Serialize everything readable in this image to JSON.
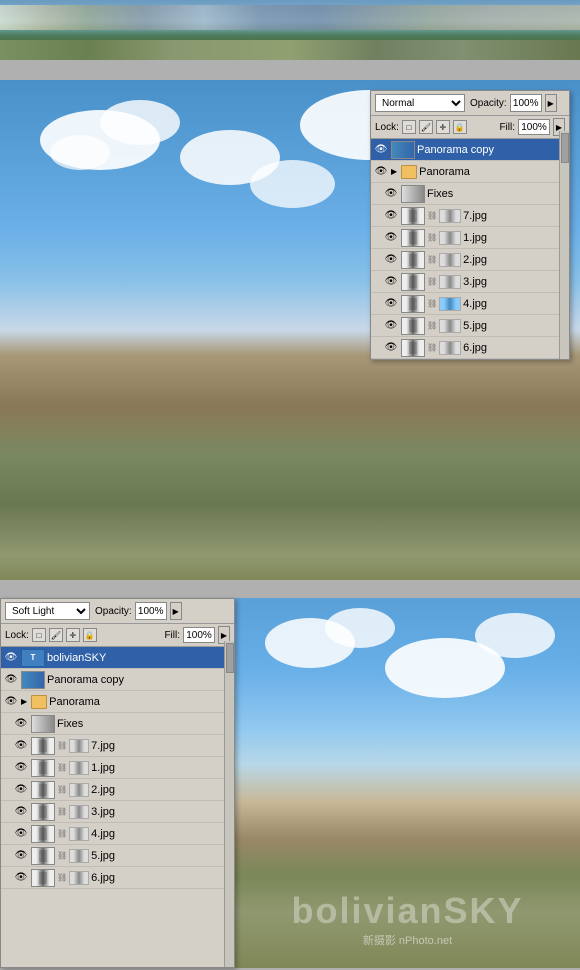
{
  "topPanel": {
    "blendMode": "Normal",
    "opacity": "100%",
    "fill": "100%",
    "lockLabel": "Lock:",
    "opacityLabel": "Opacity:",
    "fillLabel": "Fill:",
    "layers": [
      {
        "id": "panorama-copy",
        "name": "Panorama copy",
        "type": "smart",
        "selected": true,
        "indent": 0
      },
      {
        "id": "panorama-group",
        "name": "Panorama",
        "type": "group",
        "indent": 0
      },
      {
        "id": "fixes",
        "name": "Fixes",
        "type": "adjustment",
        "indent": 1
      },
      {
        "id": "7jpg",
        "name": "7.jpg",
        "type": "file",
        "indent": 1
      },
      {
        "id": "1jpg",
        "name": "1.jpg",
        "type": "file",
        "indent": 1
      },
      {
        "id": "2jpg",
        "name": "2.jpg",
        "type": "file",
        "indent": 1
      },
      {
        "id": "3jpg",
        "name": "3.jpg",
        "type": "file",
        "indent": 1
      },
      {
        "id": "4jpg",
        "name": "4.jpg",
        "type": "file",
        "indent": 1
      },
      {
        "id": "5jpg",
        "name": "5.jpg",
        "type": "file",
        "indent": 1
      },
      {
        "id": "6jpg",
        "name": "6.jpg",
        "type": "file",
        "indent": 1
      }
    ]
  },
  "bottomPanel": {
    "blendMode": "Soft Light",
    "opacity": "100%",
    "fill": "100%",
    "lockLabel": "Lock:",
    "opacityLabel": "Opacity:",
    "fillLabel": "Fill:",
    "layers": [
      {
        "id": "bolivianSKY",
        "name": "bolivianSKY",
        "type": "text",
        "selected": true,
        "indent": 0
      },
      {
        "id": "panorama-copy2",
        "name": "Panorama copy",
        "type": "smart",
        "indent": 0
      },
      {
        "id": "panorama-group2",
        "name": "Panorama",
        "type": "group",
        "indent": 0
      },
      {
        "id": "fixes2",
        "name": "Fixes",
        "type": "adjustment",
        "indent": 1
      },
      {
        "id": "7jpg2",
        "name": "7.jpg",
        "type": "file",
        "indent": 1
      },
      {
        "id": "1jpg2",
        "name": "1.jpg",
        "type": "file",
        "indent": 1
      },
      {
        "id": "2jpg2",
        "name": "2.jpg",
        "type": "file",
        "indent": 1
      },
      {
        "id": "3jpg2",
        "name": "3.jpg",
        "type": "file",
        "indent": 1
      },
      {
        "id": "4jpg2",
        "name": "4.jpg",
        "type": "file",
        "indent": 1
      },
      {
        "id": "5jpg2",
        "name": "5.jpg",
        "type": "file",
        "indent": 1
      },
      {
        "id": "6jpg2",
        "name": "6.jpg",
        "type": "file",
        "indent": 1
      }
    ]
  },
  "watermark": {
    "main": "bolivianSKY",
    "sub": "新摄影 nPhoto.net"
  },
  "icons": {
    "eye": "👁",
    "arrow_right": "▶",
    "arrow_down": "▼",
    "folder": "📁",
    "lock_pixel": "□",
    "lock_pos": "✛",
    "lock_all": "🔒",
    "chain": "⛓"
  }
}
